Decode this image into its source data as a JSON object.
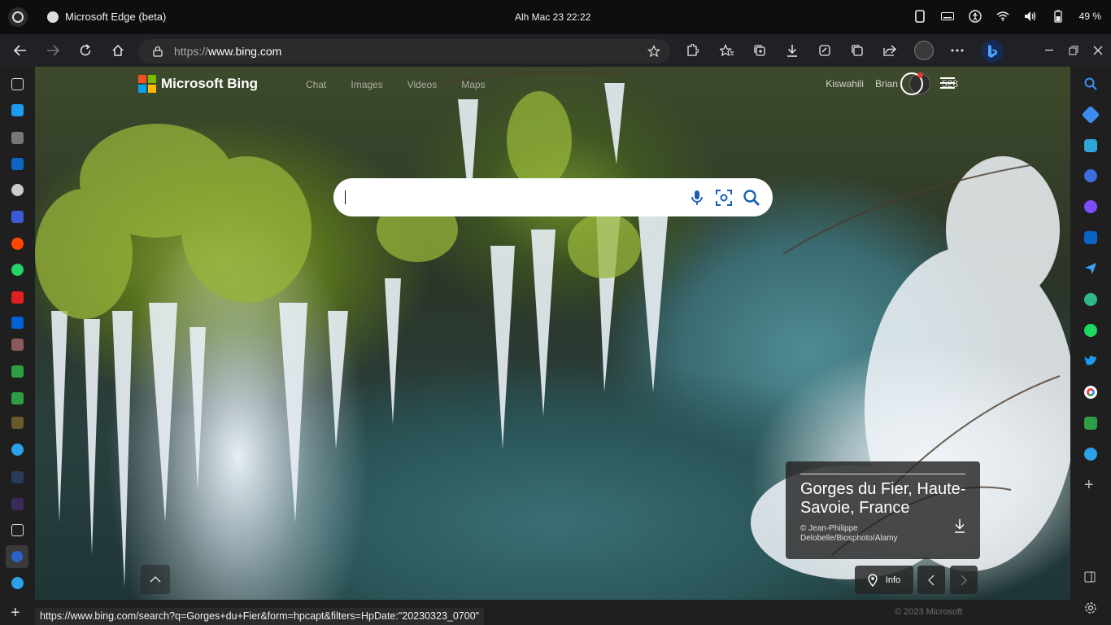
{
  "system_bar": {
    "app_title": "Microsoft Edge (beta)",
    "clock": "Alh Mac 23  22:22",
    "battery_percent": "49 %",
    "icons": [
      "screen-icon",
      "keyboard-icon",
      "accessibility-icon",
      "wifi-icon",
      "volume-icon",
      "battery-icon"
    ]
  },
  "toolbar": {
    "url_prefix": "https://",
    "url_host": "www.bing.com",
    "icons": [
      "back-icon",
      "forward-icon",
      "refresh-icon",
      "home-icon",
      "extensions-icon",
      "favorites-icon",
      "collections-icon",
      "downloads-icon",
      "performance-icon",
      "tab-actions-icon",
      "share-icon",
      "profile-icon",
      "more-icon",
      "bing-chat-icon"
    ]
  },
  "bing": {
    "logo_text": "Microsoft Bing",
    "nav": [
      "Chat",
      "Images",
      "Videos",
      "Maps"
    ],
    "language": "Kiswahili",
    "user_name": "Brian",
    "points": "528",
    "search_placeholder": ""
  },
  "caption": {
    "title": "Gorges du Fier, Haute-Savoie, France",
    "credit": "© Jean-Philippe Delobelle/Biosphoto/Alamy",
    "info_label": "Info"
  },
  "status_url": "https://www.bing.com/search?q=Gorges+du+Fier&form=hpcapt&filters=HpDate:\"20230323_0700\"",
  "copyright": "© 2023 Microsoft",
  "colors": {
    "ms_red": "#f25022",
    "ms_green": "#7fba00",
    "ms_blue": "#00a4ef",
    "ms_yellow": "#ffb900",
    "bing_icon_blue": "#1c5ad8"
  }
}
